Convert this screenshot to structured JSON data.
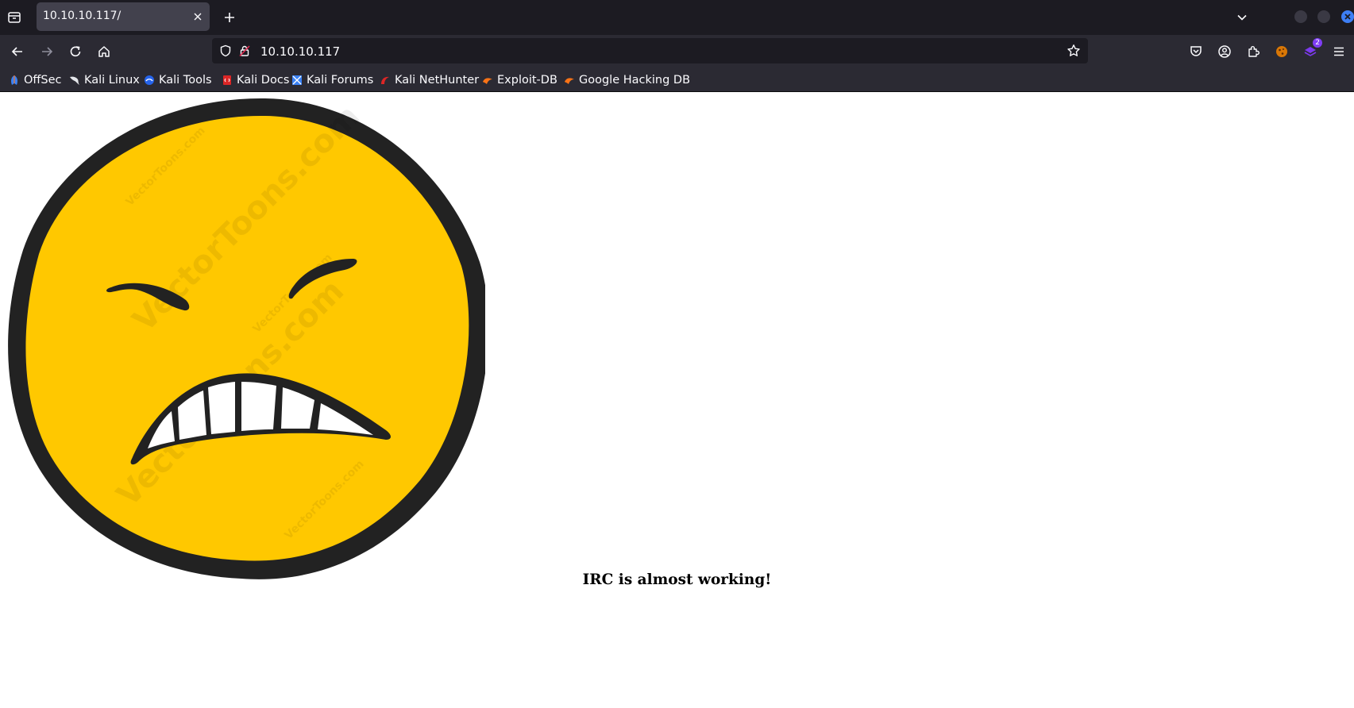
{
  "browser": {
    "tab": {
      "title": "10.10.10.117/"
    },
    "address_bar": {
      "url": "10.10.10.117"
    },
    "bookmarks": [
      {
        "label": "OffSec",
        "icon": "offsec-icon",
        "color": "#3b82f6"
      },
      {
        "label": "Kali Linux",
        "icon": "kali-dragon-icon",
        "color": "#111111"
      },
      {
        "label": "Kali Tools",
        "icon": "kali-tools-icon",
        "color": "#2563eb"
      },
      {
        "label": "Kali Docs",
        "icon": "kali-docs-icon",
        "color": "#dc2626"
      },
      {
        "label": "Kali Forums",
        "icon": "kali-forums-icon",
        "color": "#3b82f6"
      },
      {
        "label": "Kali NetHunter",
        "icon": "nethunter-icon",
        "color": "#dc2626"
      },
      {
        "label": "Exploit-DB",
        "icon": "exploit-db-icon",
        "color": "#f97316"
      },
      {
        "label": "Google Hacking DB",
        "icon": "ghdb-icon",
        "color": "#f97316"
      }
    ],
    "extensions_badge": "2"
  },
  "page": {
    "heading": "IRC is almost working!",
    "image": {
      "description_name": "angry-smiley-image",
      "watermark": "VectorToons.com"
    }
  },
  "colors": {
    "tabstrip": "#1c1b22",
    "toolbar": "#2b2a33",
    "smiley_face": "#ffc800",
    "smiley_outline": "#222222"
  }
}
